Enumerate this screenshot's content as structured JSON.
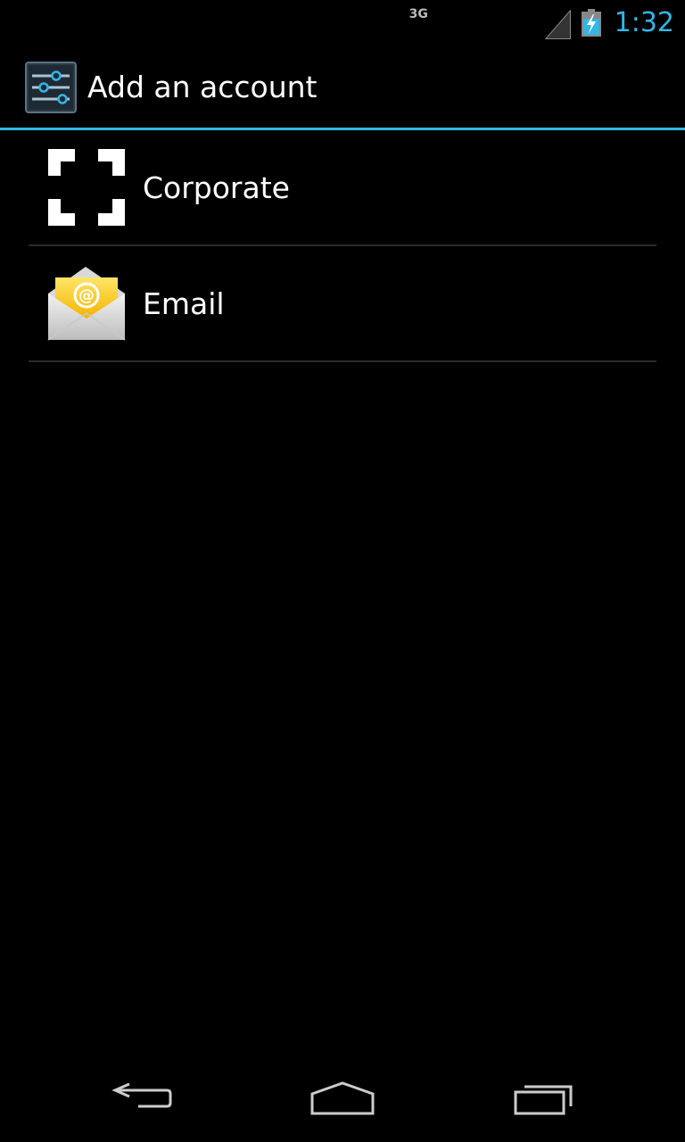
{
  "status_bar": {
    "network_type": "3G",
    "time": "1:32",
    "accent_color": "#33b5e5"
  },
  "action_bar": {
    "title": "Add an account",
    "icon": "settings-sliders-icon"
  },
  "accounts": [
    {
      "label": "Corporate",
      "icon": "corporate-frame-icon"
    },
    {
      "label": "Email",
      "icon": "email-envelope-icon"
    }
  ],
  "nav_bar": {
    "back_icon": "back-icon",
    "home_icon": "home-icon",
    "recents_icon": "recent-apps-icon"
  }
}
